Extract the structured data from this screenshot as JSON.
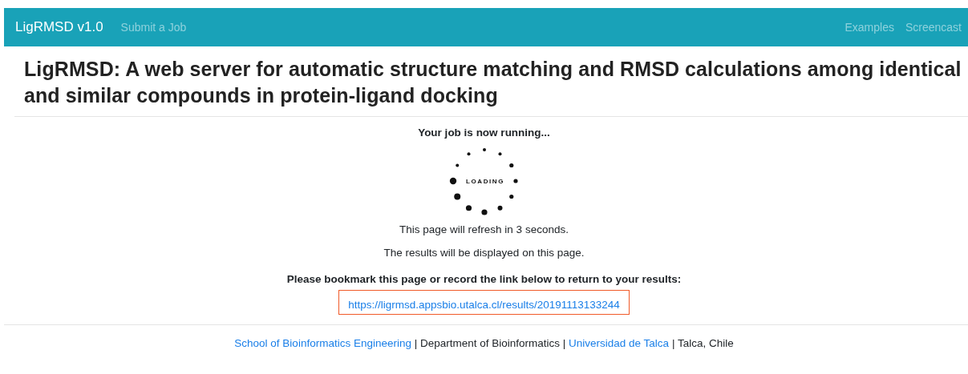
{
  "navbar": {
    "brand": "LigRMSD v1.0",
    "left_links": [
      "Submit a Job"
    ],
    "right_links": [
      "Examples",
      "Screencast"
    ]
  },
  "title": "LigRMSD: A web server for automatic structure matching and RMSD calculations among identical and similar compounds in protein-ligand docking",
  "status": {
    "heading": "Your job is now running...",
    "spinner_label": "LOADING",
    "messages": [
      "This page will refresh in 3 seconds.",
      "The results will be displayed on this page."
    ],
    "bookmark_note": "Please bookmark this page or record the link below to return to your results:",
    "result_link": "https://ligrmsd.appsbio.utalca.cl/results/20191113133244"
  },
  "footer": [
    {
      "kind": "link",
      "text": "School of Bioinformatics Engineering"
    },
    {
      "kind": "text",
      "text": " | Department of Bioinformatics | "
    },
    {
      "kind": "link",
      "text": "Universidad de Talca"
    },
    {
      "kind": "text",
      "text": " | Talca, Chile"
    }
  ]
}
